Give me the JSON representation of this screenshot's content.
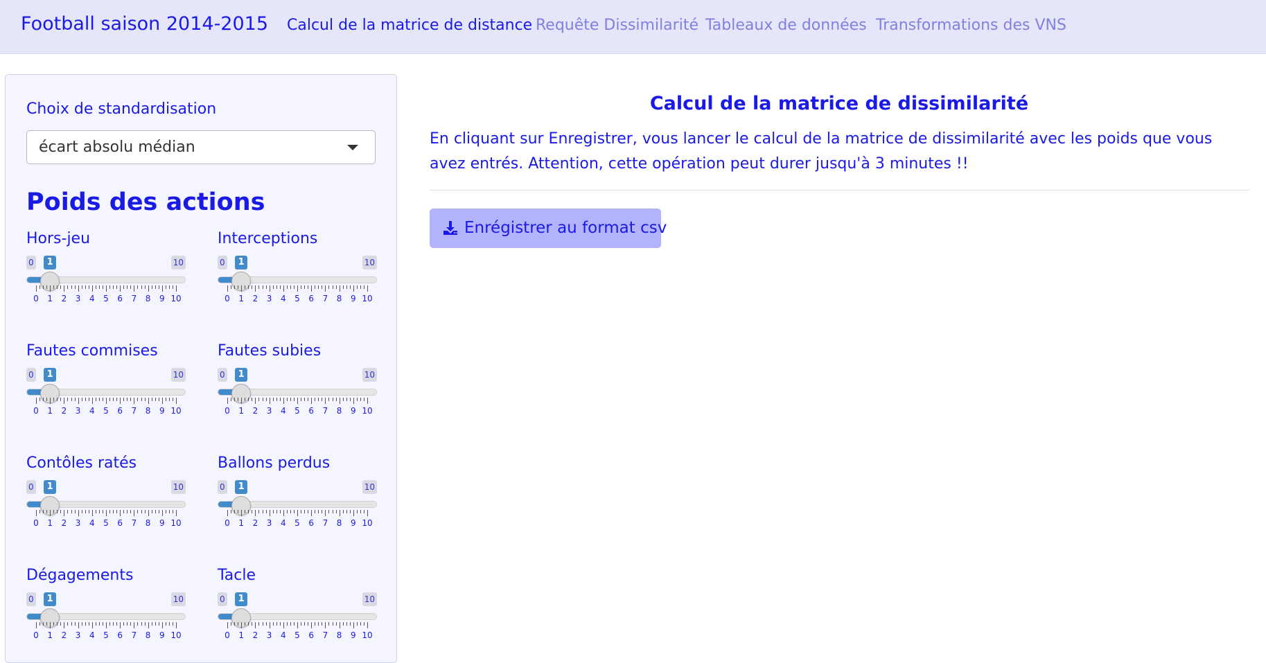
{
  "navbar": {
    "brand": "Football saison 2014-2015",
    "tabs": [
      {
        "label": "Calcul de la matrice de distance",
        "active": true
      },
      {
        "label": "Requête Dissimilarité",
        "active": false
      },
      {
        "label": "Tableaux de données",
        "active": false
      },
      {
        "label": "Transformations des VNS",
        "active": false
      }
    ]
  },
  "sidebar": {
    "standardisation_label": "Choix de standardisation",
    "standardisation_value": "écart absolu médian",
    "section_title": "Poids des actions",
    "sliders": [
      {
        "label": "Hors-jeu",
        "min": 0,
        "max": 10,
        "value": 1
      },
      {
        "label": "Interceptions",
        "min": 0,
        "max": 10,
        "value": 1
      },
      {
        "label": "Fautes commises",
        "min": 0,
        "max": 10,
        "value": 1
      },
      {
        "label": "Fautes subies",
        "min": 0,
        "max": 10,
        "value": 1
      },
      {
        "label": "Contôles ratés",
        "min": 0,
        "max": 10,
        "value": 1
      },
      {
        "label": "Ballons perdus",
        "min": 0,
        "max": 10,
        "value": 1
      },
      {
        "label": "Dégagements",
        "min": 0,
        "max": 10,
        "value": 1
      },
      {
        "label": "Tacle",
        "min": 0,
        "max": 10,
        "value": 1
      }
    ]
  },
  "main": {
    "title": "Calcul de la matrice de dissimilarité",
    "description": "En cliquant sur Enregistrer, vous lancer le calcul de la matrice de dissimilarité avec les poids que vous avez entrés. Attention, cette opération peut durer jusqu'à 3 minutes !!",
    "download_label": "Enrégistrer au format csv",
    "download_icon": "download-icon"
  },
  "colors": {
    "accent": "#1a1ae6",
    "navbar_bg": "#e6e6fa",
    "slider_fill": "#428bca",
    "button_bg": "#b3b3fb"
  }
}
